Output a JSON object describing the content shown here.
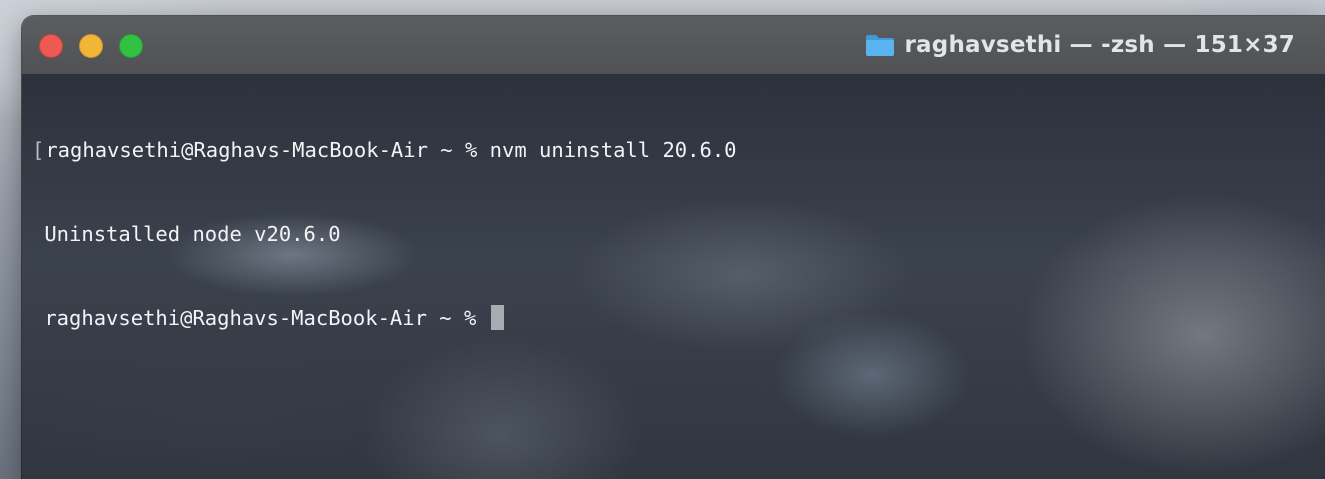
{
  "window": {
    "title": "raghavsethi — -zsh — 151×37",
    "icon": "folder-icon"
  },
  "terminal": {
    "lines": [
      {
        "prompt": "raghavsethi@Raghavs-MacBook-Air ~ % ",
        "command": "nvm uninstall 20.6.0"
      },
      {
        "output": "Uninstalled node v20.6.0"
      },
      {
        "prompt": "raghavsethi@Raghavs-MacBook-Air ~ % ",
        "command": ""
      }
    ]
  },
  "colors": {
    "close": "#ee5a52",
    "minimize": "#f2b538",
    "maximize": "#32c142",
    "folder": "#5ab4f0"
  }
}
